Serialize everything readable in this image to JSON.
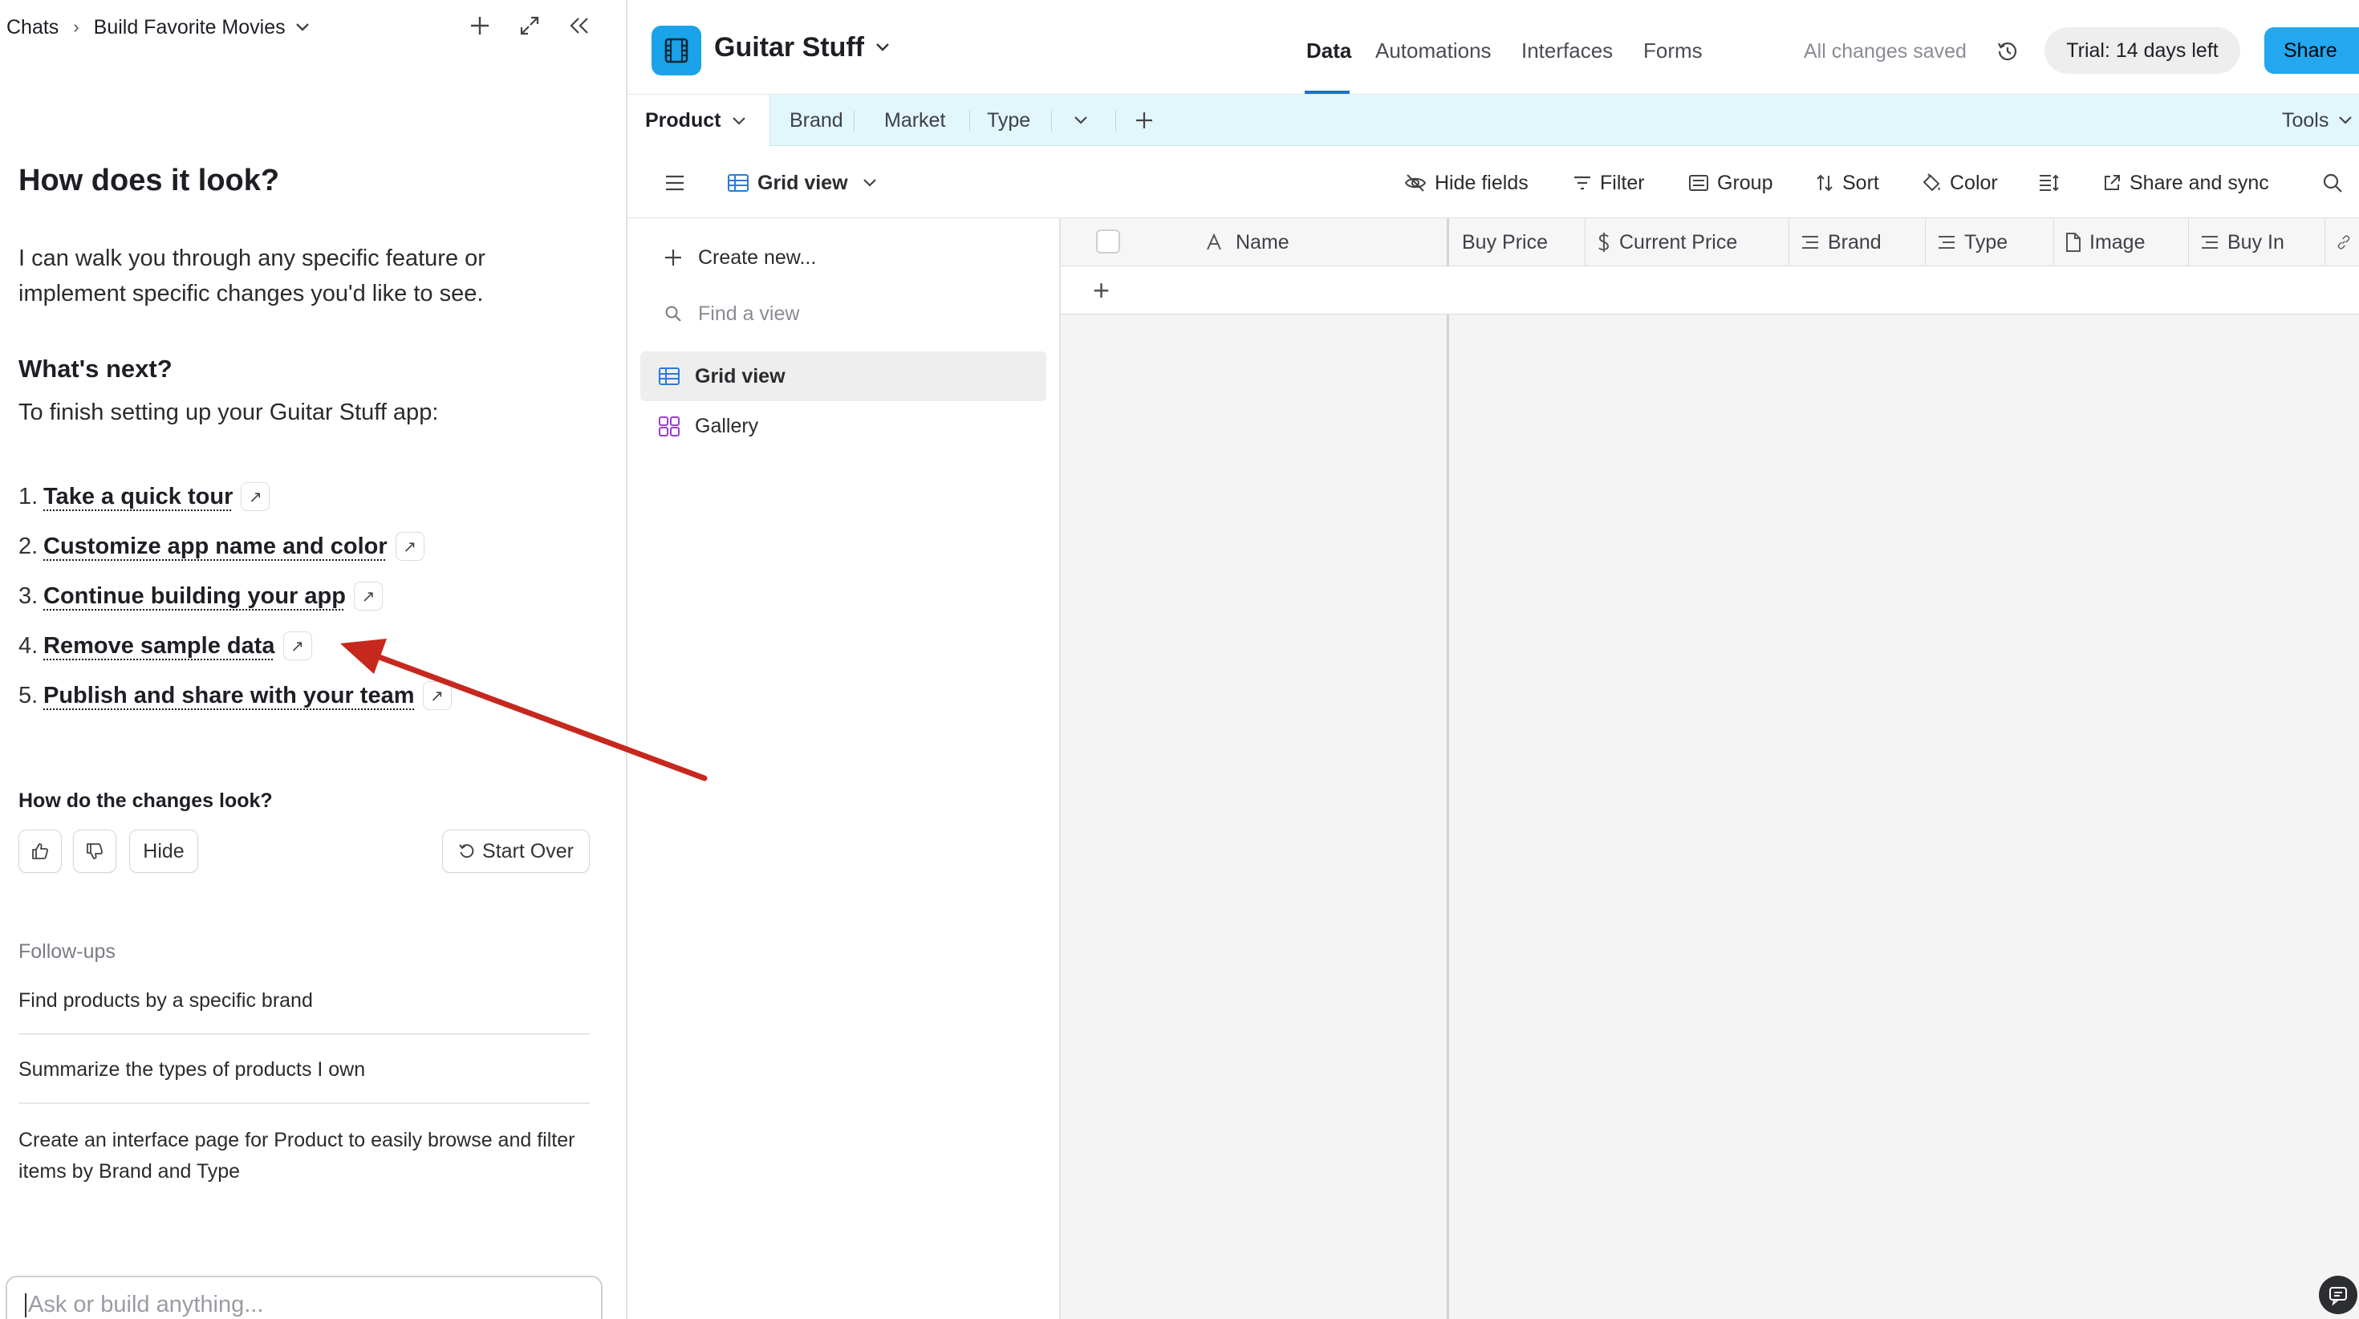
{
  "chat": {
    "breadcrumb_root": "Chats",
    "breadcrumb_current": "Build Favorite Movies",
    "heading": "How does it look?",
    "intro": "I can walk you through any specific feature or implement specific changes you'd like to see.",
    "next_heading": "What's next?",
    "next_intro": "To finish setting up your Guitar Stuff app:",
    "steps": [
      {
        "num": "1.",
        "label": "Take a quick tour"
      },
      {
        "num": "2.",
        "label": "Customize app name and color"
      },
      {
        "num": "3.",
        "label": "Continue building your app"
      },
      {
        "num": "4.",
        "label": "Remove sample data"
      },
      {
        "num": "5.",
        "label": "Publish and share with your team"
      }
    ],
    "feedback_question": "How do the changes look?",
    "hide_label": "Hide",
    "start_over_label": "Start Over",
    "followups_title": "Follow-ups",
    "followups": [
      "Find products by a specific brand",
      "Summarize the types of products I own",
      "Create an interface page for Product to easily browse and filter items by Brand and Type"
    ],
    "input_placeholder": "Ask or build anything..."
  },
  "app": {
    "name": "Guitar Stuff",
    "nav": [
      "Data",
      "Automations",
      "Interfaces",
      "Forms"
    ],
    "saved_status": "All changes saved",
    "trial_label": "Trial: 14 days left",
    "share_label": "Share",
    "tables": [
      "Product",
      "Brand",
      "Market",
      "Type"
    ],
    "tools_label": "Tools",
    "view_name": "Grid view",
    "toolbar": {
      "hide_fields": "Hide fields",
      "filter": "Filter",
      "group": "Group",
      "sort": "Sort",
      "color": "Color",
      "share_sync": "Share and sync"
    },
    "views_panel": {
      "create_new": "Create new...",
      "find_placeholder": "Find a view",
      "views": [
        "Grid view",
        "Gallery"
      ]
    },
    "columns": [
      "Name",
      "Buy Price",
      "Current Price",
      "Brand",
      "Type",
      "Image",
      "Buy In"
    ]
  },
  "colors": {
    "accent": "#23a7ee",
    "logo": "#1aa3e8",
    "tablebar": "#e2f7fb",
    "arrow": "#c6281e",
    "gallery_icon": "#9b3fcf"
  }
}
